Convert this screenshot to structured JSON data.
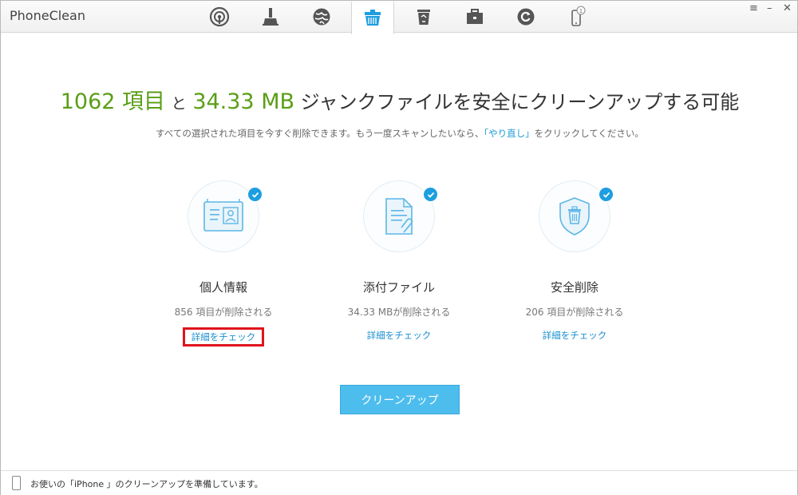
{
  "app": {
    "title": "PhoneClean"
  },
  "toolbar": {
    "icons": [
      "signal-icon",
      "quick-clean-icon",
      "internet-clean-icon",
      "silent-clean-icon",
      "recycle-icon",
      "toolbox-icon",
      "restore-icon",
      "device-icon"
    ],
    "device_badge": "1",
    "menu_glyph": "≡",
    "minimize_glyph": "–",
    "close_glyph": "✕"
  },
  "main": {
    "headline": {
      "count": "1062 項目",
      "conj": "と",
      "size": "34.33 MB",
      "text": "ジャンクファイルを安全にクリーンアップする可能"
    },
    "subtext": {
      "before": "すべての選択された項目を今すぐ削除できます。もう一度スキャンしたいなら、",
      "link": "「やり直し」",
      "after": "をクリックしてください。"
    },
    "cards": [
      {
        "title": "個人情報",
        "count": "856 項目が削除される",
        "link": "詳細をチェック"
      },
      {
        "title": "添付ファイル",
        "count": "34.33 MBが削除される",
        "link": "詳細をチェック"
      },
      {
        "title": "安全削除",
        "count": "206 項目が削除される",
        "link": "詳細をチェック"
      }
    ],
    "cleanup_button": "クリーンアップ"
  },
  "status": {
    "message": "お使いの「iPhone 」のクリーンアップを準備しています。"
  },
  "colors": {
    "accent": "#1d9ee0",
    "green": "#5a9e16",
    "button": "#4dbdee",
    "highlight": "#e0131c"
  }
}
